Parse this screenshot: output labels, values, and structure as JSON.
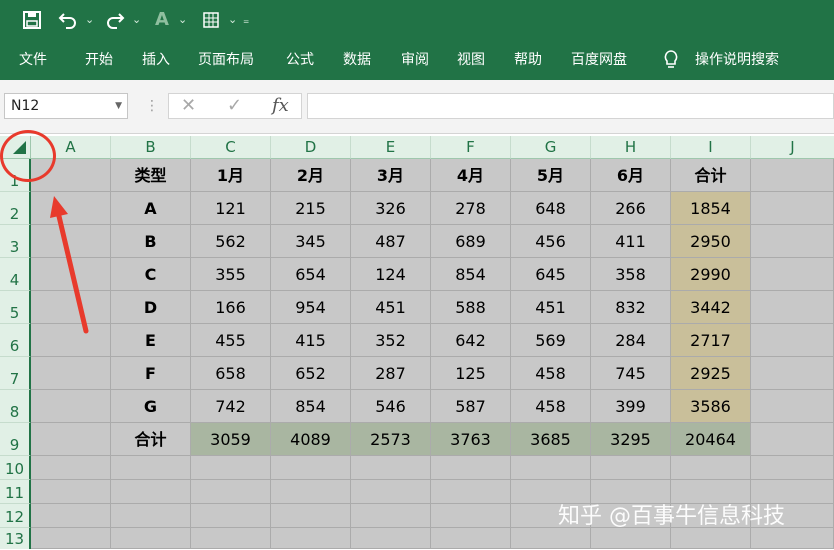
{
  "qat": {
    "save_icon": "save-icon",
    "undo_icon": "undo-icon",
    "redo_icon": "redo-icon",
    "font_color_label": "A",
    "more_icon": "customize-icon"
  },
  "ribbon": {
    "tabs": [
      "文件",
      "开始",
      "插入",
      "页面布局",
      "公式",
      "数据",
      "审阅",
      "视图",
      "帮助",
      "百度网盘"
    ],
    "tell_me": "操作说明搜索"
  },
  "formula_bar": {
    "name_box": "N12",
    "cancel": "✕",
    "enter": "✓",
    "fx": "fx",
    "content": ""
  },
  "columns": [
    "A",
    "B",
    "C",
    "D",
    "E",
    "F",
    "G",
    "H",
    "I",
    "J"
  ],
  "rows": [
    "1",
    "2",
    "3",
    "4",
    "5",
    "6",
    "7",
    "8",
    "9",
    "10",
    "11",
    "12",
    "13"
  ],
  "table": {
    "header": [
      "类型",
      "1月",
      "2月",
      "3月",
      "4月",
      "5月",
      "6月",
      "合计"
    ],
    "body": [
      [
        "A",
        "121",
        "215",
        "326",
        "278",
        "648",
        "266",
        "1854"
      ],
      [
        "B",
        "562",
        "345",
        "487",
        "689",
        "456",
        "411",
        "2950"
      ],
      [
        "C",
        "355",
        "654",
        "124",
        "854",
        "645",
        "358",
        "2990"
      ],
      [
        "D",
        "166",
        "954",
        "451",
        "588",
        "451",
        "832",
        "3442"
      ],
      [
        "E",
        "455",
        "415",
        "352",
        "642",
        "569",
        "284",
        "2717"
      ],
      [
        "F",
        "658",
        "652",
        "287",
        "125",
        "458",
        "745",
        "2925"
      ],
      [
        "G",
        "742",
        "854",
        "546",
        "587",
        "458",
        "399",
        "3586"
      ]
    ],
    "total": [
      "合计",
      "3059",
      "4089",
      "2573",
      "3763",
      "3685",
      "3295",
      "20464"
    ]
  },
  "watermark": "知乎 @百事牛信息科技",
  "colors": {
    "excel_green": "#217346",
    "header_bg": "#e1f0e6",
    "cell_gray": "#c8c8c8",
    "total_col": "#c9bf9a",
    "total_row": "#a9b6a1",
    "annotation_red": "#e83a2c"
  }
}
